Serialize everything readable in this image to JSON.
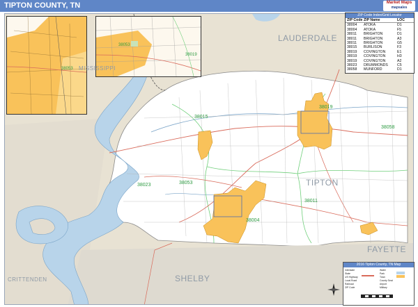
{
  "header": {
    "title": "TIPTON COUNTY, TN",
    "brand_line1": "Market Maps",
    "brand_line2": "mapsales"
  },
  "counties": {
    "lauderdale": "LAUDERDALE",
    "tipton": "TIPTON",
    "fayette": "FAYETTE",
    "shelby": "SHELBY",
    "crittenden": "CRITTENDEN",
    "mississippi": "MISSISSIPPI"
  },
  "zip_labels": {
    "z1": "38019",
    "z2": "38015",
    "z3": "38023",
    "z4": "38053",
    "z5": "38004",
    "z6": "38011",
    "z7": "38058"
  },
  "insets": {
    "inset1_zip": "38053",
    "inset2_zip": "38053",
    "inset2_zip_b": "38019"
  },
  "locator": {
    "title": "ZIP Code Index/Grid Locator",
    "headers": [
      "ZIP Code",
      "ZIP Name",
      "LOC"
    ],
    "rows": [
      [
        "38004",
        "ATOKA",
        "D1"
      ],
      [
        "38004",
        "ATOKA",
        "F5"
      ],
      [
        "38011",
        "BRIGHTON",
        "D1"
      ],
      [
        "38011",
        "BRIGHTON",
        "A3"
      ],
      [
        "38011",
        "BRIGHTON",
        "G5"
      ],
      [
        "38015",
        "BURLISON",
        "F3"
      ],
      [
        "38019",
        "COVINGTON",
        "E1"
      ],
      [
        "38019",
        "COVINGTON",
        "H3"
      ],
      [
        "38019",
        "COVINGTON",
        "A2"
      ],
      [
        "38023",
        "DRUMMONDS",
        "C5"
      ],
      [
        "38058",
        "MUNFORD",
        "D1"
      ]
    ]
  },
  "legend": {
    "title": "2016 Tipton County, TN Map",
    "items": [
      "Interstate",
      "State",
      "US Highway",
      "Local Road",
      "Railroad",
      "ZIP Code",
      "Water",
      "Park",
      "Town",
      "County Seat",
      "Airport",
      "Military"
    ]
  },
  "colors": {
    "header": "#5f86c7",
    "county_fill": "#ffffff",
    "outside": "#e6dfcf",
    "water": "#b8d4ea",
    "town": "#f9c25a",
    "zip_line": "#6fcf7a",
    "road_state": "#d96a5a"
  }
}
